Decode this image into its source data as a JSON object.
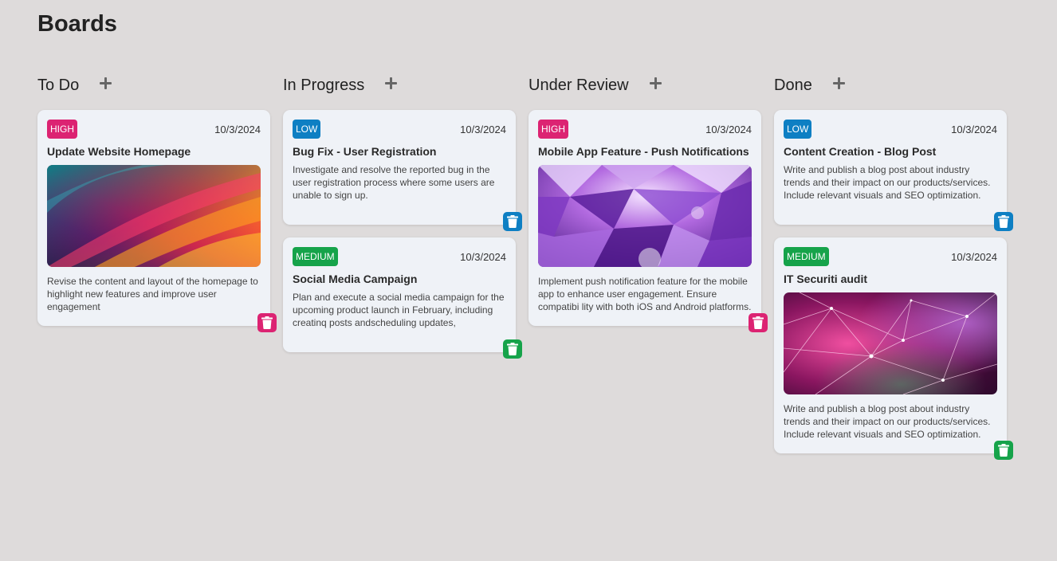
{
  "page": {
    "title": "Boards"
  },
  "colors": {
    "high": "#dc2372",
    "low": "#0e7fc3",
    "medium": "#16a34a",
    "background": "#dedbdb",
    "card": "#eff2f7"
  },
  "columns": [
    {
      "title": "To Do",
      "add_icon": "plus-icon",
      "cards": [
        {
          "priority": "HIGH",
          "date": "10/3/2024",
          "title": "Update Website Homepage",
          "image": "abstract-waves",
          "description": "Revise the content and layout of the homepage to highlight new features and improve user engagement",
          "delete_icon": "trash-icon"
        }
      ]
    },
    {
      "title": "In Progress",
      "add_icon": "plus-icon",
      "cards": [
        {
          "priority": "LOW",
          "date": "10/3/2024",
          "title": "Bug Fix - User Registration",
          "description": "Investigate and resolve the reported bug in the user registration process where some users are unable to sign up.",
          "delete_icon": "trash-icon"
        },
        {
          "priority": "MEDIUM",
          "date": "10/3/2024",
          "title": "Social Media Campaign",
          "description": "Plan and execute a social media campaign for the upcoming product launch in February, including creatinq posts andscheduling updates,",
          "delete_icon": "trash-icon"
        }
      ]
    },
    {
      "title": "Under Review",
      "add_icon": "plus-icon",
      "cards": [
        {
          "priority": "HIGH",
          "date": "10/3/2024",
          "title": "Mobile App Feature - Push Notifications",
          "image": "purple-polygons",
          "description": "Implement push notification feature for the mobile app to enhance user engagement. Ensure compatibi lity with both iOS and Android platforms.",
          "delete_icon": "trash-icon"
        }
      ]
    },
    {
      "title": "Done",
      "add_icon": "plus-icon",
      "cards": [
        {
          "priority": "LOW",
          "date": "10/3/2024",
          "title": "Content Creation - Blog Post",
          "description": "Write and publish a blog post about industry trends and their impact on our products/services. Include relevant visuals and SEO optimization.",
          "delete_icon": "trash-icon"
        },
        {
          "priority": "MEDIUM",
          "date": "10/3/2024",
          "title": "IT Securiti audit",
          "image": "pink-network",
          "description": "Write and publish a blog post about industry trends and their impact on our products/services. Include relevant visuals and SEO optimization.",
          "delete_icon": "trash-icon"
        }
      ]
    }
  ]
}
